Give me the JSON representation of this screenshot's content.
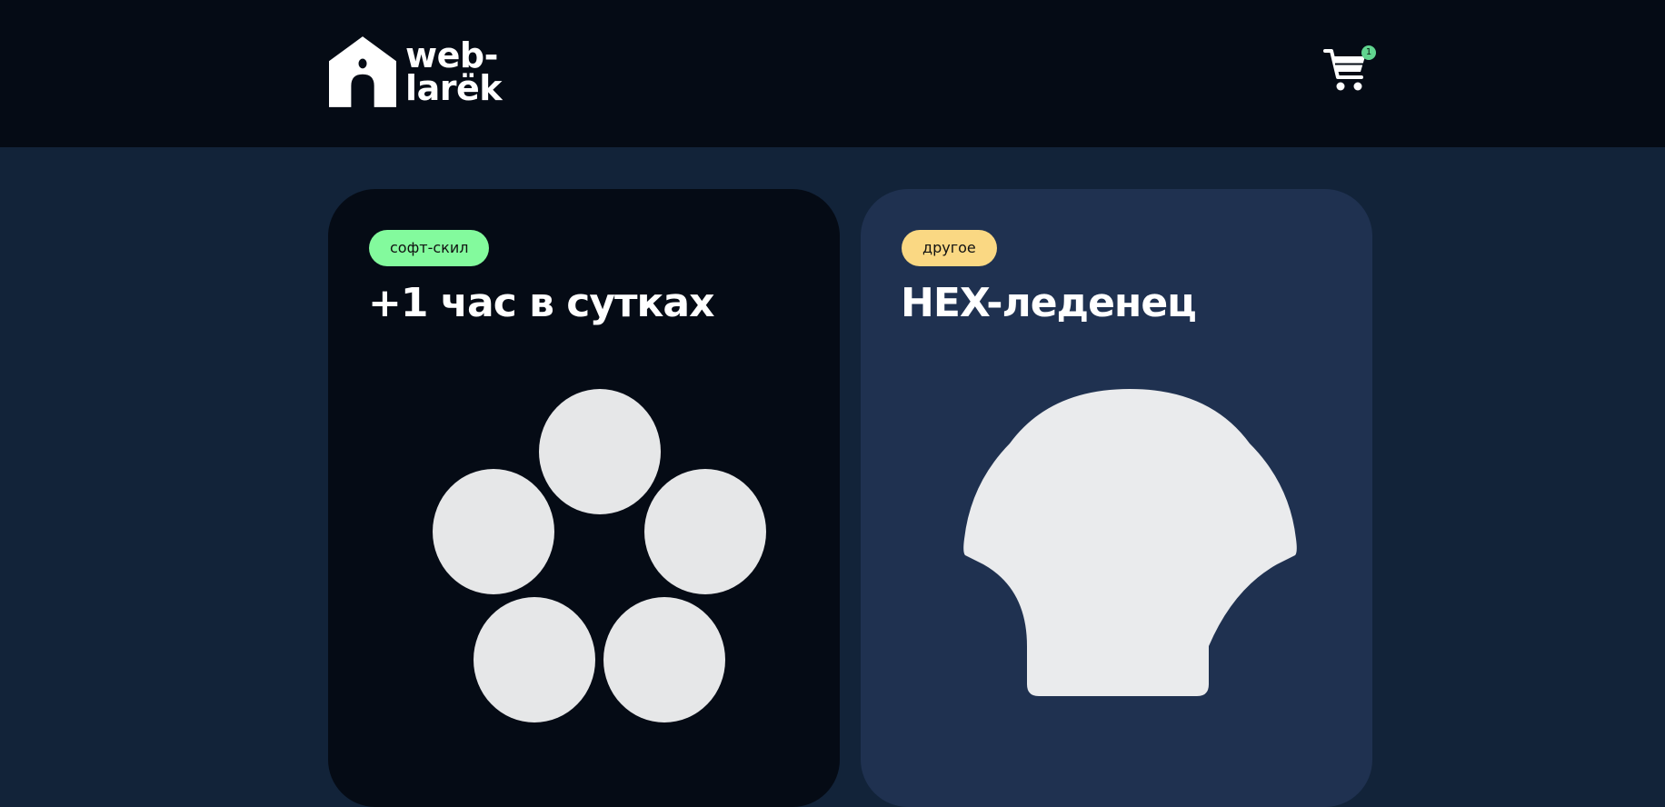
{
  "header": {
    "logo": {
      "line1": "web-",
      "line2": "larёk"
    },
    "cart": {
      "counter": "1",
      "icon": "cart-icon"
    }
  },
  "catalog": {
    "cards": [
      {
        "category": "софт-скил",
        "category_color": "#83fa9d",
        "title": "+1 час в сутках",
        "image_icon": "five-circles-icon"
      },
      {
        "category": "другое",
        "category_color": "#fad883",
        "title": "HEX-леденец",
        "image_icon": "shell-candy-icon"
      }
    ]
  },
  "colors": {
    "header_bg": "#050b15",
    "page_bg": "#122339",
    "card_dark": "#050b15",
    "card_light": "#1f3150",
    "accent_green": "#61d58f"
  }
}
